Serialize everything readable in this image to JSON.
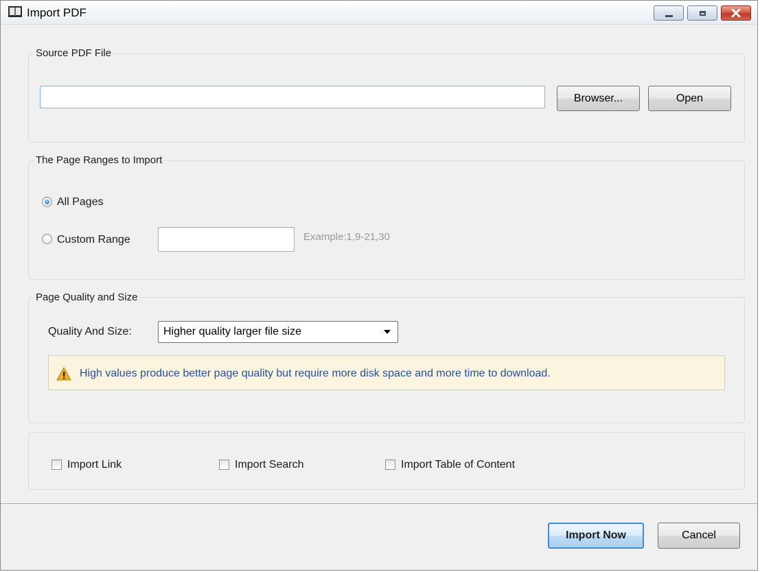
{
  "window": {
    "title": "Import PDF",
    "controls": {
      "minimize": "minimize-icon",
      "maximize": "maximize-icon",
      "close": "close-icon"
    }
  },
  "source_group": {
    "title": "Source PDF File",
    "path_value": "",
    "browse_label": "Browser...",
    "open_label": "Open"
  },
  "range_group": {
    "title": "The Page Ranges to Import",
    "all_pages_label": "All Pages",
    "all_pages_checked": true,
    "custom_range_label": "Custom Range",
    "custom_range_checked": false,
    "custom_range_value": "",
    "example_hint": "Example:1,9-21,30"
  },
  "quality_group": {
    "title": "Page Quality and Size",
    "quality_label": "Quality And Size:",
    "quality_selected": "Higher quality larger file size",
    "warning_icon": "warning-icon",
    "warning_text": "High values produce better page quality but require more disk space and more time to download."
  },
  "options_group": {
    "import_link_label": "Import Link",
    "import_link_checked": false,
    "import_search_label": "Import Search",
    "import_search_checked": false,
    "import_toc_label": "Import Table of Content",
    "import_toc_checked": false
  },
  "footer": {
    "import_now_label": "Import Now",
    "cancel_label": "Cancel"
  },
  "colors": {
    "accent": "#3c8cd4",
    "warning_text": "#2a4f9a",
    "warning_bg": "#fbf5df"
  }
}
